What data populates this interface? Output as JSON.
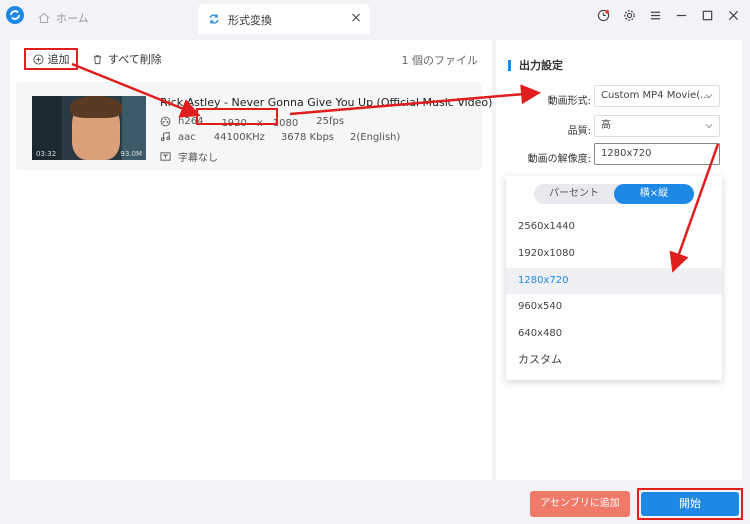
{
  "titlebar": {
    "home_tab": "ホーム",
    "active_tab": "形式変換",
    "close": "×"
  },
  "toolbar": {
    "add_label": "追加",
    "delete_all_label": "すべて削除",
    "file_count": "1 個のファイル"
  },
  "file": {
    "title": "Rick Astley - Never Gonna Give You Up (Official Music Video)",
    "duration": "03:32",
    "size": "93.0M",
    "video_codec": "h264",
    "resolution": "1920　x　1080",
    "fps": "25fps",
    "audio_codec": "aac",
    "sample_rate": "44100KHz",
    "bitrate": "3678 Kbps",
    "channels": "2(English)",
    "subtitle": "字幕なし"
  },
  "output": {
    "title": "出力設定",
    "format_label": "動画形式:",
    "format_value": "Custom MP4 Movie(...",
    "quality_label": "品質:",
    "quality_value": "高",
    "resolution_label": "動画の解像度:",
    "resolution_value": "1280x720"
  },
  "dropdown": {
    "seg_left": "パーセント",
    "seg_right": "横×縦",
    "options": [
      "2560x1440",
      "1920x1080",
      "1280x720",
      "960x540",
      "640x480",
      "カスタム"
    ],
    "selected_index": 2
  },
  "buttons": {
    "assemble": "アセンブリに追加",
    "start": "開始"
  },
  "colors": {
    "accent": "#1e88e5",
    "highlight": "#e01e1e",
    "assemble": "#f07a6a"
  }
}
